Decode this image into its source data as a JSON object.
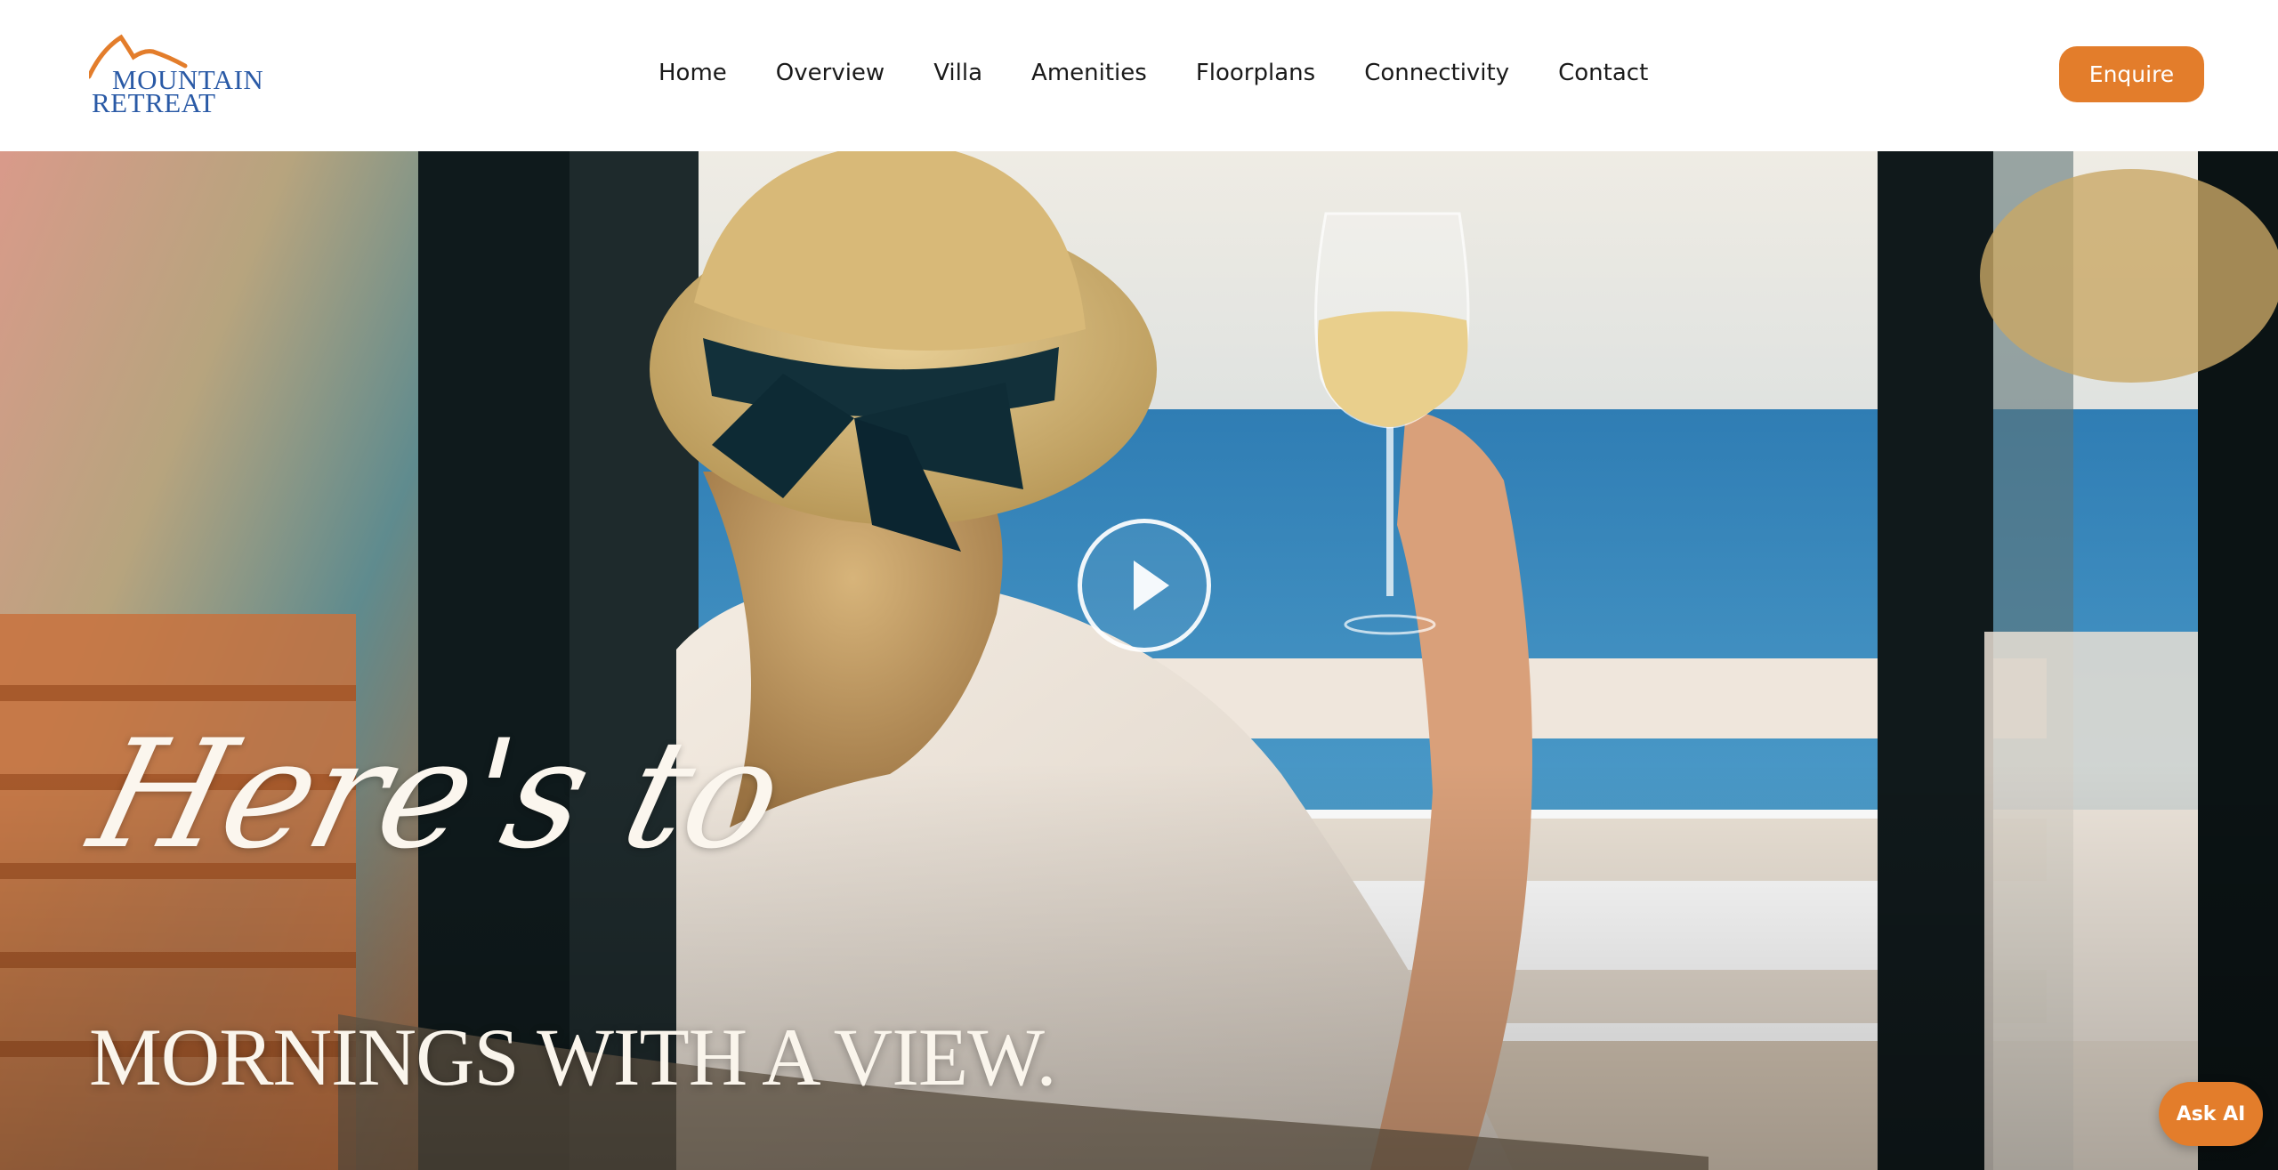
{
  "header": {
    "logo": {
      "line1": "MOUNTAIN",
      "line2": "RETREAT"
    },
    "nav": [
      "Home",
      "Overview",
      "Villa",
      "Amenities",
      "Floorplans",
      "Connectivity",
      "Contact"
    ],
    "enquire_label": "Enquire"
  },
  "hero": {
    "script_text": "Here's to",
    "headline": "MORNINGS WITH A VIEW.",
    "play_icon": "play-icon"
  },
  "ask_ai_label": "Ask AI",
  "colors": {
    "accent": "#e37d2b",
    "logo_blue": "#2a5aa6",
    "logo_orange": "#e37d2b"
  }
}
